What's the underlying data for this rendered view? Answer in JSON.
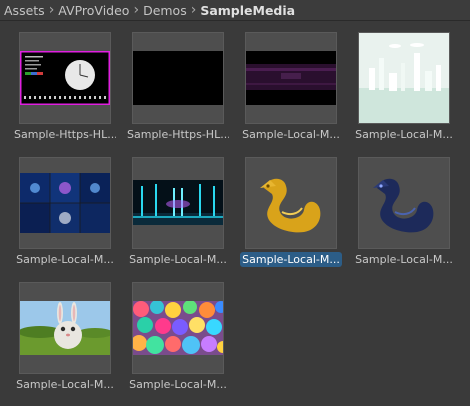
{
  "breadcrumb": {
    "items": [
      "Assets",
      "AVProVideo",
      "Demos",
      "SampleMedia"
    ],
    "separator": "›"
  },
  "assets": [
    {
      "label": "Sample-Https-HL...",
      "thumbnail": "hls-test-pattern",
      "selected": false
    },
    {
      "label": "Sample-Https-HL...",
      "thumbnail": "black-video",
      "selected": false
    },
    {
      "label": "Sample-Local-M...",
      "thumbnail": "dark-purple-band",
      "selected": false
    },
    {
      "label": "Sample-Local-M...",
      "thumbnail": "white-city-360",
      "selected": false
    },
    {
      "label": "Sample-Local-M...",
      "thumbnail": "blue-tunnel-cubemap",
      "selected": false
    },
    {
      "label": "Sample-Local-M...",
      "thumbnail": "cyan-hall-equirect",
      "selected": false
    },
    {
      "label": "Sample-Local-M...",
      "thumbnail": "gold-dragon",
      "selected": true
    },
    {
      "label": "Sample-Local-M...",
      "thumbnail": "blue-dragon",
      "selected": false
    },
    {
      "label": "Sample-Local-M...",
      "thumbnail": "big-buck-bunny",
      "selected": false
    },
    {
      "label": "Sample-Local-M...",
      "thumbnail": "colorful-spheres",
      "selected": false
    }
  ],
  "colors": {
    "background": "#3a3a3a",
    "selection": "#2c5d87",
    "hls_border": "#e020e0"
  }
}
